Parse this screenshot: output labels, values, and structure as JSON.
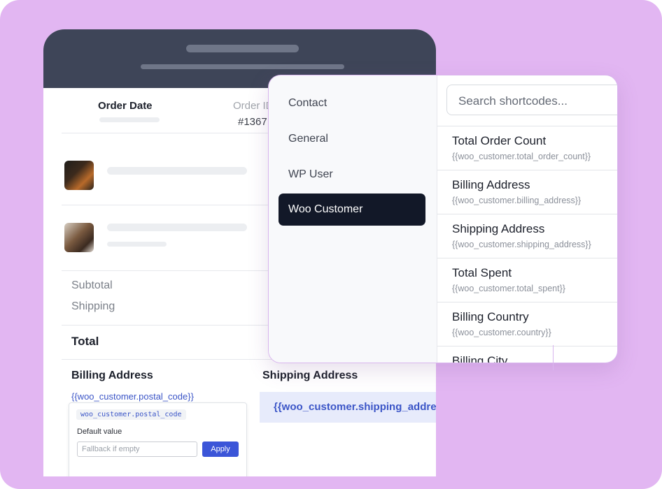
{
  "order": {
    "order_date_label": "Order Date",
    "order_id_label": "Order ID",
    "order_id_value": "#1367",
    "subtotal_label": "Subtotal",
    "shipping_label": "Shipping",
    "total_label": "Total",
    "billing_title": "Billing Address",
    "shipping_title": "Shipping Address",
    "billing_shortcode": "{{woo_customer.postal_code}}",
    "shipping_shortcode": "{{woo_customer.shipping_address}}"
  },
  "popover": {
    "chip": "woo_customer.postal_code",
    "default_label": "Default value",
    "input_placeholder": "Fallback if empty",
    "apply_label": "Apply"
  },
  "panel": {
    "categories": [
      "Contact",
      "General",
      "WP User",
      "Woo Customer"
    ],
    "active_category": "Woo Customer",
    "search_placeholder": "Search shortcodes...",
    "items": [
      {
        "title": "Total Order Count",
        "code": "{{woo_customer.total_order_count}}"
      },
      {
        "title": "Billing Address",
        "code": "{{woo_customer.billing_address}}"
      },
      {
        "title": "Shipping Address",
        "code": "{{woo_customer.shipping_address}}"
      },
      {
        "title": "Total Spent",
        "code": "{{woo_customer.total_spent}}"
      },
      {
        "title": "Billing Country",
        "code": "{{woo_customer.country}}"
      },
      {
        "title": "Billing City",
        "code": ""
      }
    ]
  },
  "colors": {
    "background": "#e2b6f2",
    "header": "#3e4558",
    "active_category": "#121828",
    "shortcode_accent": "#3b55c7"
  }
}
